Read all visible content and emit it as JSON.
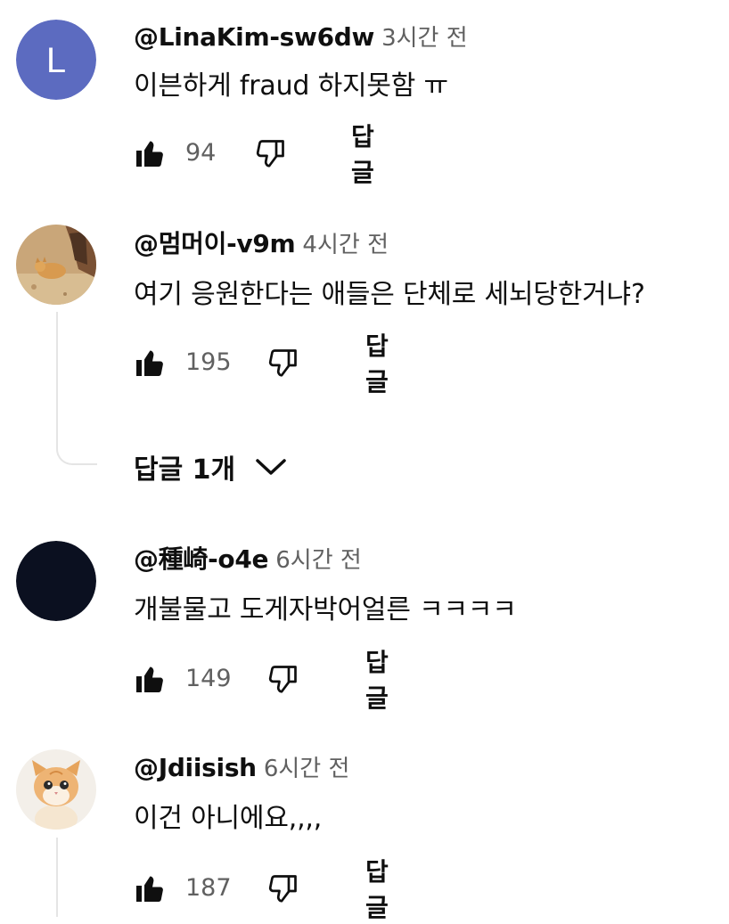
{
  "comments": [
    {
      "author": "@LinaKim-sw6dw",
      "time": "3시간 전",
      "text": "이븐하게 fraud 하지못함 ㅠ",
      "likes": "94",
      "reply_label": "답글",
      "avatar": {
        "type": "letter",
        "letter": "L",
        "color": "#5c6bc0"
      }
    },
    {
      "author": "@멈머이-v9m",
      "time": "4시간 전",
      "text": "여기 응원한다는 애들은 단체로 세뇌당한거냐?",
      "likes": "195",
      "reply_label": "답글",
      "avatar": {
        "type": "image",
        "desc": "cat-photo"
      },
      "replies_toggle": "답글 1개"
    },
    {
      "author": "@種崎-o4e",
      "time": "6시간 전",
      "text": "개불물고 도게자박어얼른 ㅋㅋㅋㅋ",
      "likes": "149",
      "reply_label": "답글",
      "avatar": {
        "type": "solid",
        "color": "#0b1020"
      }
    },
    {
      "author": "@Jdiisish",
      "time": "6시간 전",
      "text": "이건 아니에요,,,,",
      "likes": "187",
      "reply_label": "답글",
      "avatar": {
        "type": "image",
        "desc": "kitten-photo"
      }
    }
  ],
  "icons": {
    "like": "thumbs-up-icon",
    "dislike": "thumbs-down-icon",
    "expand": "chevron-down-icon"
  },
  "colors": {
    "text_primary": "#0f0f0f",
    "text_secondary": "#606060",
    "thread_line": "#e5e5e5"
  }
}
